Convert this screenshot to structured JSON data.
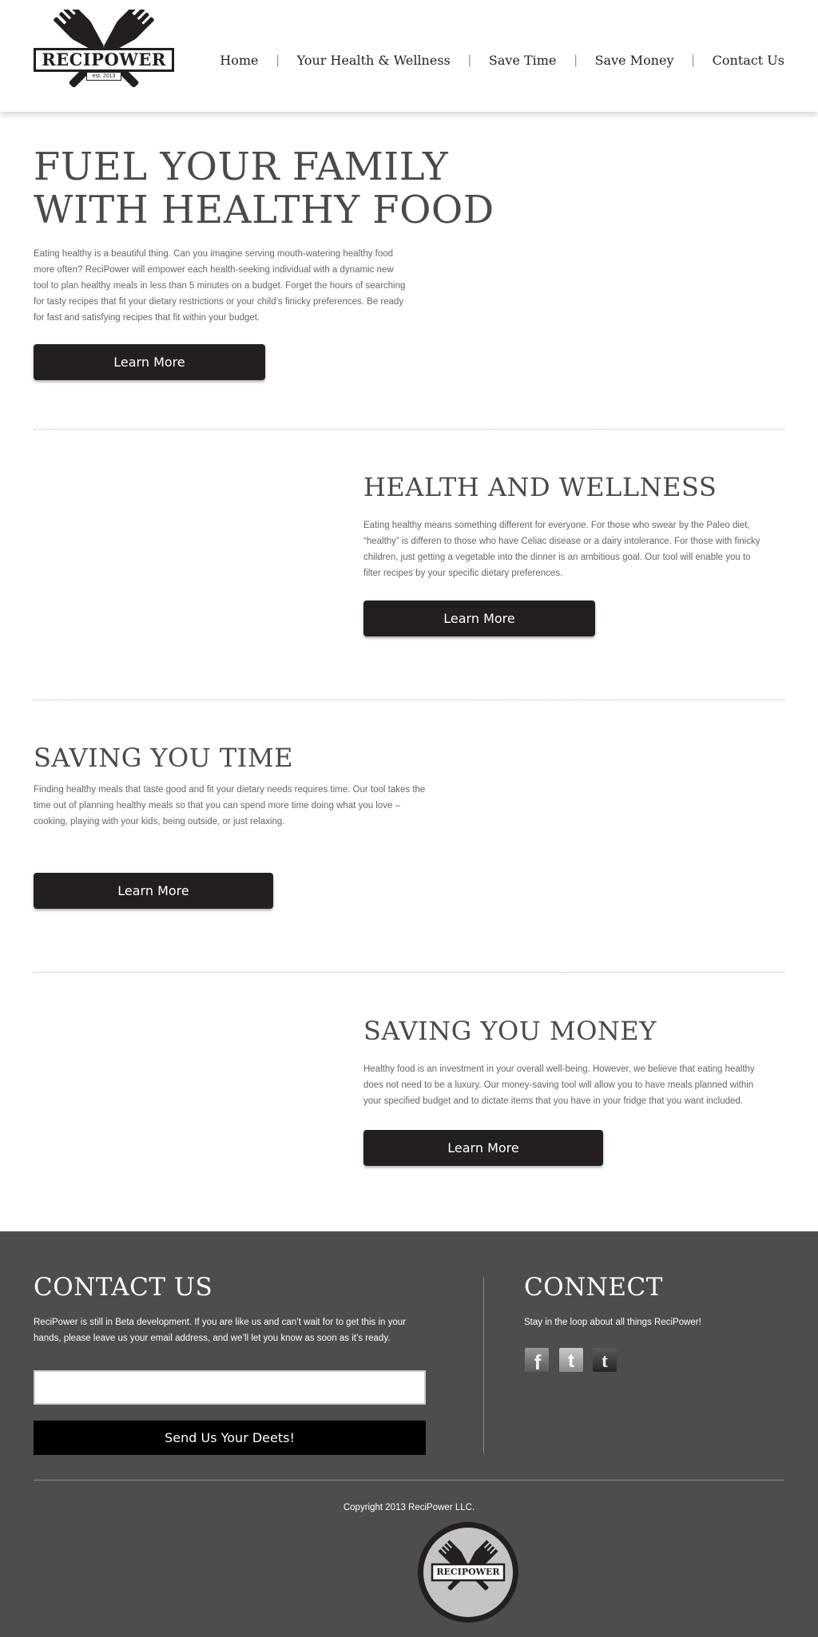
{
  "header": {
    "logo": {
      "brand": "RECIPOWER",
      "est": "est. 2013",
      "icon": "crossed-forks-icon"
    },
    "nav": [
      {
        "label": "Home"
      },
      {
        "label": "Your Health & Wellness"
      },
      {
        "label": "Save Time"
      },
      {
        "label": "Save Money"
      },
      {
        "label": "Contact Us"
      }
    ]
  },
  "hero": {
    "title_line1": "FUEL YOUR FAMILY",
    "title_line2": "WITH HEALTHY FOOD",
    "body_lines": [
      "Eating healthy is a beautiful thing. Can you imagine serving mouth-watering  healthy food",
      "more often?  ReciPower will empower each health-seeking individual with a dynamic new",
      "tool to plan healthy meals in less than 5 minutes on a budget. Forget the hours of searching",
      "for tasty recipes that fit your dietary  restrictions or your child’s finicky preferences. Be ready",
      "for fast and satisfying recipes that fit within your budget."
    ],
    "button": "Learn More"
  },
  "health": {
    "title": "HEALTH AND WELLNESS",
    "body_lines": [
      "Eating healthy means something different for everyone.  For those who swear by the Paleo diet,",
      "“healthy” is differen to those who have Celiac disease or a dairy intolerance.  For those with finicky",
      "children, just getting a vegetable into the dinner is an ambitious goal. Our tool will enable you to",
      "filter recipes by your specific dietary preferences."
    ],
    "button": "Learn More"
  },
  "time": {
    "title": "SAVING YOU TIME",
    "body_lines": [
      "Finding healthy meals that taste good and fit your dietary needs requires time.  Our tool takes the",
      "time out of planning healthy meals so that you can spend more time doing what you love –",
      "cooking, playing with your kids, being outside, or just relaxing."
    ],
    "button": "Learn More"
  },
  "money": {
    "title": "SAVING YOU MONEY",
    "body_lines": [
      "Healthy food is an investment in your overall well-being.  However, we believe that eating healthy",
      "does not need to be a luxury. Our money-saving tool will allow you to have meals planned within",
      "your specified budget and to dictate items that you have in your fridge that you want included."
    ],
    "button": "Learn More"
  },
  "footer": {
    "contact": {
      "title": "CONTACT US",
      "body_lines": [
        "ReciPower is still in Beta development. If you are like us and can’t wait for to get  this in your",
        "hands, please leave us your email address, and we’ll let you know as soon as it’s ready."
      ],
      "input_value": "",
      "input_placeholder": "",
      "button": "Send Us Your Deets!"
    },
    "connect": {
      "title": "CONNECT",
      "text": "Stay in the loop about all things ReciPower!",
      "icons": [
        {
          "name": "facebook-icon",
          "glyph": "f"
        },
        {
          "name": "twitter-icon",
          "glyph": "t"
        },
        {
          "name": "tumblr-icon",
          "glyph": "t"
        }
      ]
    },
    "copyright": "Copyright 2013 ReciPower LLC.",
    "badge_brand": "RECIPOWER"
  },
  "colors": {
    "dark": "#231f20",
    "footer_bg": "#4d4d4d",
    "heading": "#4a4a4a",
    "body": "#666666"
  }
}
